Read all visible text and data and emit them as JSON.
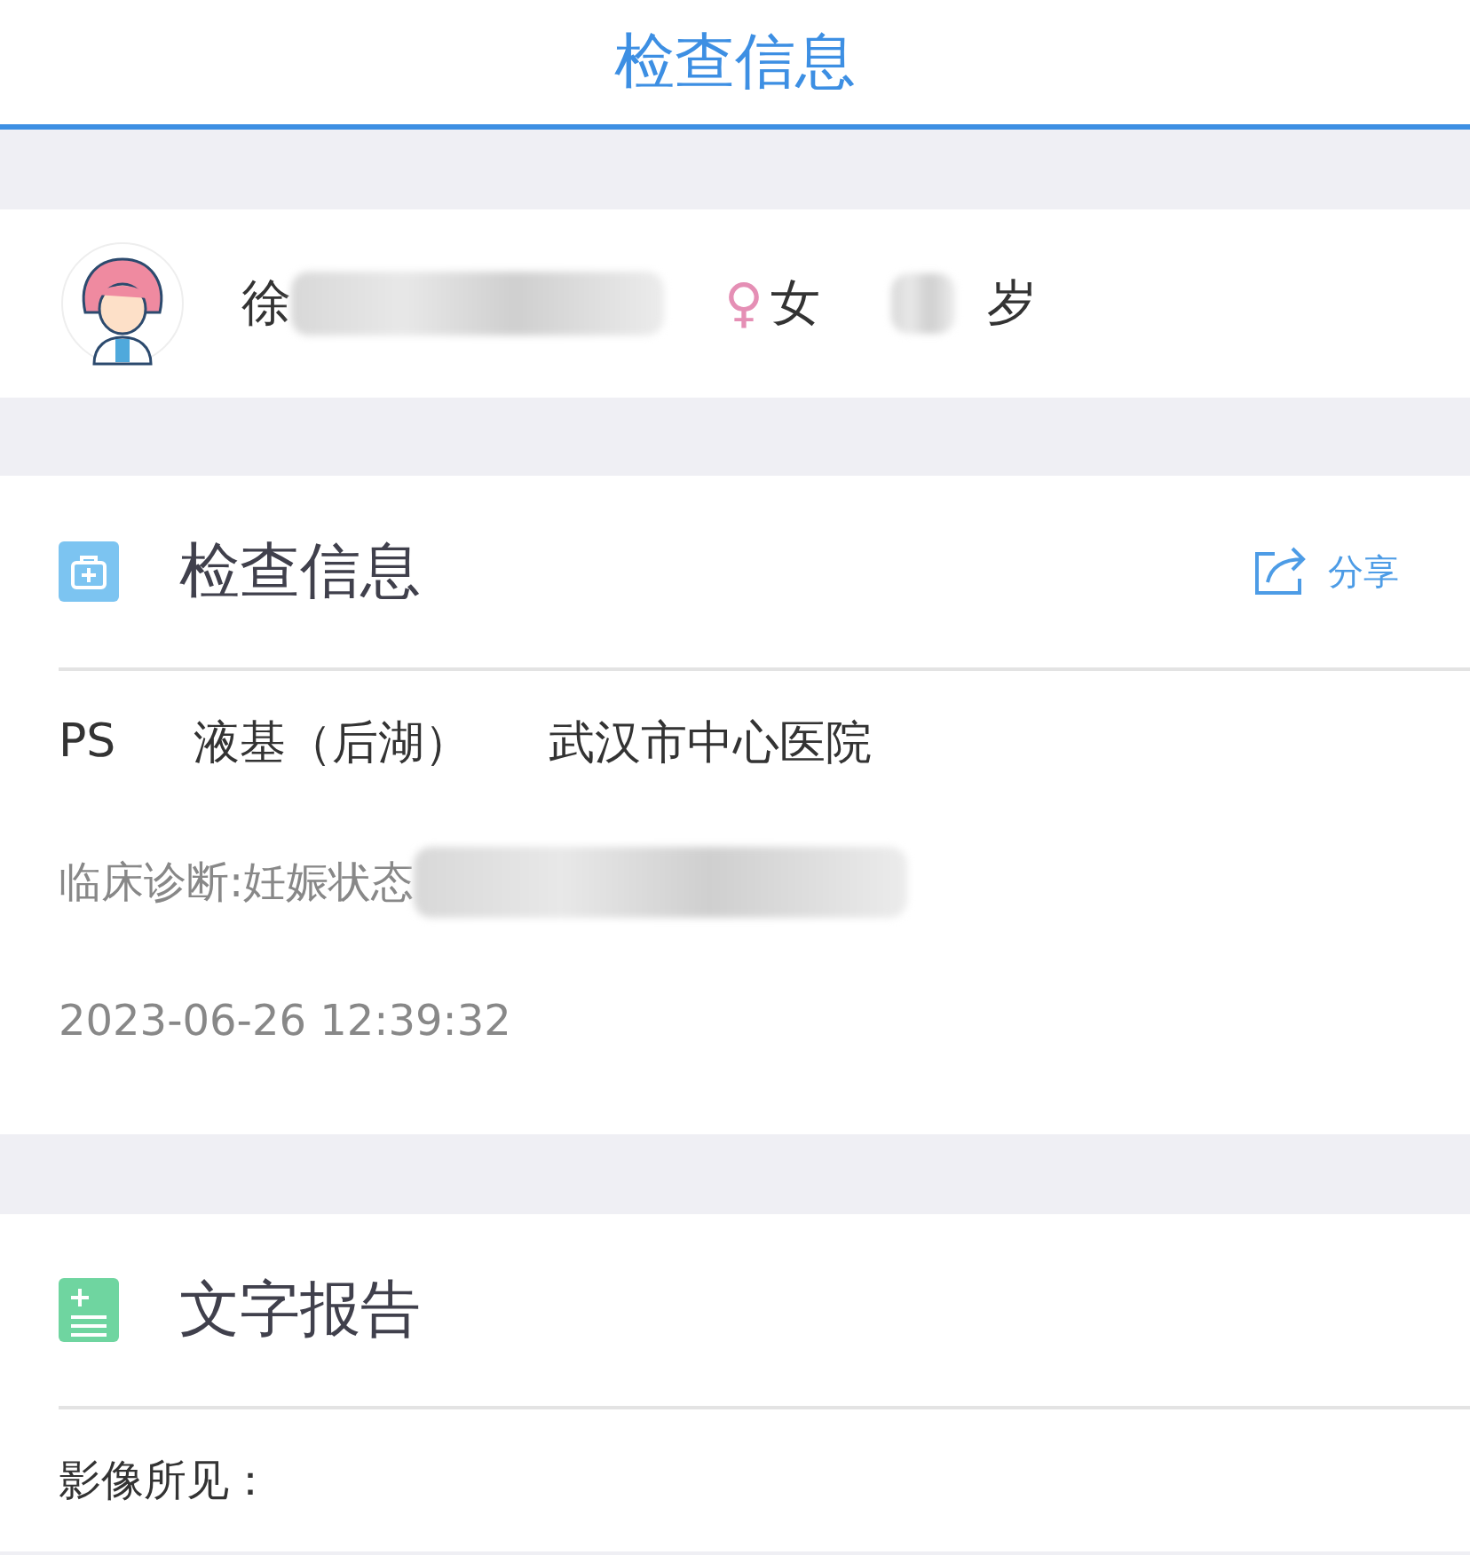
{
  "header": {
    "title": "检查信息"
  },
  "patient": {
    "name": "徐",
    "gender_symbol": "♀",
    "gender": "女",
    "age_unit": "岁"
  },
  "exam": {
    "title": "检查信息",
    "share": "分享",
    "modality": "PS",
    "department": "液基（后湖）",
    "hospital": "武汉市中心医院",
    "diagnosis": "临床诊断:妊娠状态",
    "time": "2023-06-26 12:39:32"
  },
  "report": {
    "title": "文字报告",
    "findings_label": "影像所见："
  }
}
